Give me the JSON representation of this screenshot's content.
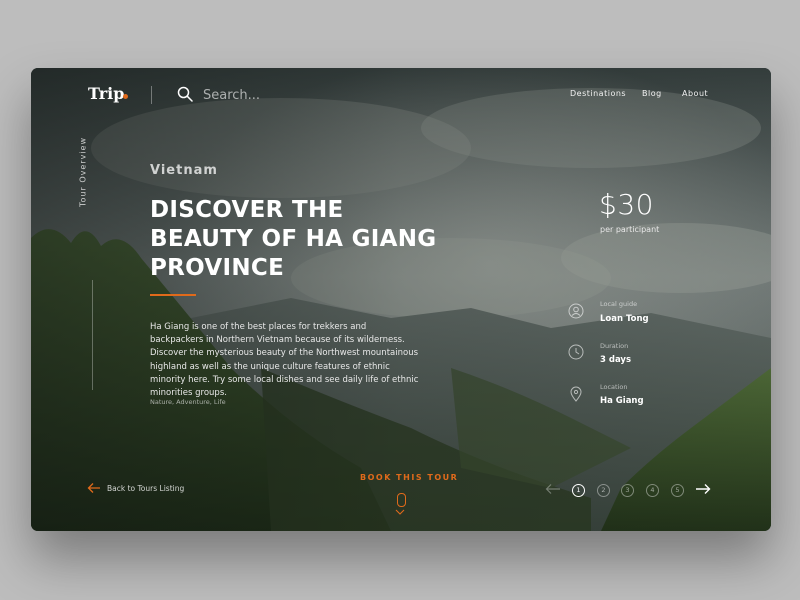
{
  "header": {
    "logo": "Trip",
    "search_placeholder": "Search...",
    "nav": [
      "Destinations",
      "Blog",
      "About"
    ]
  },
  "side": {
    "label": "Tour Overview"
  },
  "tour": {
    "country": "Vietnam",
    "title_lines": [
      "DISCOVER THE",
      "BEAUTY OF HA GIANG",
      "PROVINCE"
    ],
    "description": "Ha Giang is one of the best places for trekkers and backpackers in Northern Vietnam because of its wilderness. Discover the mysterious beauty of the Northwest mountainous highland as well as the unique culture features of ethnic minority here. Try some local dishes and see daily life of ethnic minorities groups.",
    "tags": "Nature, Adventure, Life",
    "price": "$30",
    "price_unit": "per participant",
    "info": [
      {
        "icon": "user-icon",
        "label": "Local guide",
        "value": "Loan Tong"
      },
      {
        "icon": "clock-icon",
        "label": "Duration",
        "value": "3 days"
      },
      {
        "icon": "location-pin-icon",
        "label": "Location",
        "value": "Ha Giang"
      }
    ]
  },
  "footer": {
    "back_label": "Back to Tours Listing",
    "cta_label": "BOOK THIS TOUR",
    "pages": [
      "1",
      "2",
      "3",
      "4",
      "5"
    ],
    "active_page": "1"
  },
  "colors": {
    "accent": "#e06a1b",
    "page_bg": "#bdbdbd"
  }
}
